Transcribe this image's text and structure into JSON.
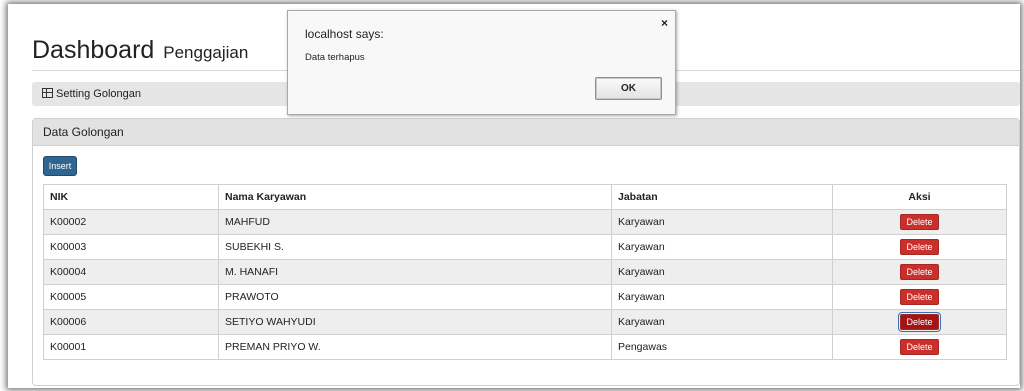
{
  "header": {
    "title": "Dashboard",
    "subtitle": "Penggajian"
  },
  "breadcrumb": {
    "icon": "table-icon",
    "label": "Setting Golongan"
  },
  "panel": {
    "title": "Data Golongan",
    "insert_label": "Insert"
  },
  "table": {
    "columns": [
      "NIK",
      "Nama Karyawan",
      "Jabatan",
      "Aksi"
    ],
    "delete_label": "Delete",
    "rows": [
      {
        "nik": "K00002",
        "nama": "MAHFUD",
        "jabatan": "Karyawan"
      },
      {
        "nik": "K00003",
        "nama": "SUBEKHI S.",
        "jabatan": "Karyawan"
      },
      {
        "nik": "K00004",
        "nama": "M. HANAFI",
        "jabatan": "Karyawan"
      },
      {
        "nik": "K00005",
        "nama": "PRAWOTO",
        "jabatan": "Karyawan"
      },
      {
        "nik": "K00006",
        "nama": "SETIYO WAHYUDI",
        "jabatan": "Karyawan"
      },
      {
        "nik": "K00001",
        "nama": "PREMAN PRIYO W.",
        "jabatan": "Pengawas"
      }
    ]
  },
  "dialog": {
    "title": "localhost says:",
    "message": "Data terhapus",
    "ok_label": "OK",
    "close_label": "×"
  },
  "colors": {
    "insert_button": "#2f6591",
    "delete_button": "#c9302c"
  }
}
